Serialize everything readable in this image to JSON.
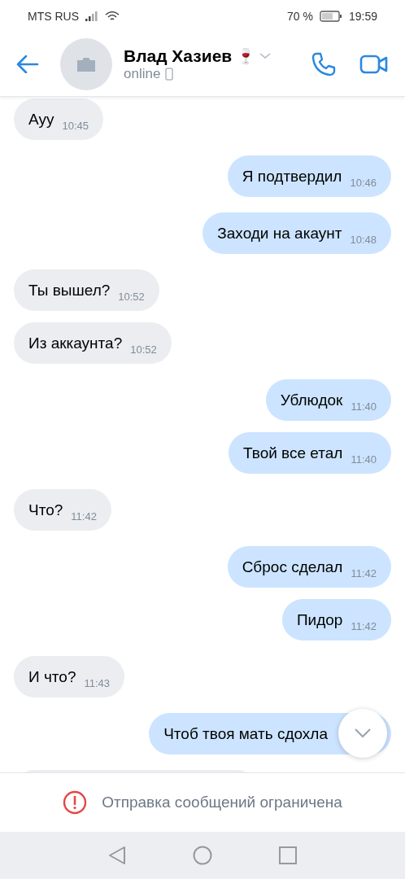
{
  "status_bar": {
    "carrier": "MTS RUS",
    "battery": "70 %",
    "time": "19:59"
  },
  "header": {
    "name": "Влад Хазиев",
    "emoji": "🍷",
    "status": "online"
  },
  "messages": [
    {
      "kind": "incoming",
      "text": "Ауу",
      "time": "10:45"
    },
    {
      "kind": "outgoing",
      "text": "Я подтвердил",
      "time": "10:46"
    },
    {
      "kind": "outgoing",
      "text": "Заходи на акаунт",
      "time": "10:48"
    },
    {
      "kind": "incoming",
      "text": "Ты вышел?",
      "time": "10:52"
    },
    {
      "kind": "incoming",
      "text": "Из аккаунта?",
      "time": "10:52"
    },
    {
      "kind": "outgoing",
      "text": "Ублюдок",
      "time": "11:40"
    },
    {
      "kind": "outgoing",
      "text": "Твой все етал",
      "time": "11:40"
    },
    {
      "kind": "incoming",
      "text": "Что?",
      "time": "11:42"
    },
    {
      "kind": "outgoing",
      "text": "Сброс сделал",
      "time": "11:42"
    },
    {
      "kind": "outgoing",
      "text": "Пидор",
      "time": "11:42"
    },
    {
      "kind": "incoming",
      "text": "И что?",
      "time": "11:43"
    },
    {
      "kind": "outgoing",
      "text": "Чтоб твоя мать сдохла"
    }
  ],
  "notice": "Отправка сообщений ограничена"
}
